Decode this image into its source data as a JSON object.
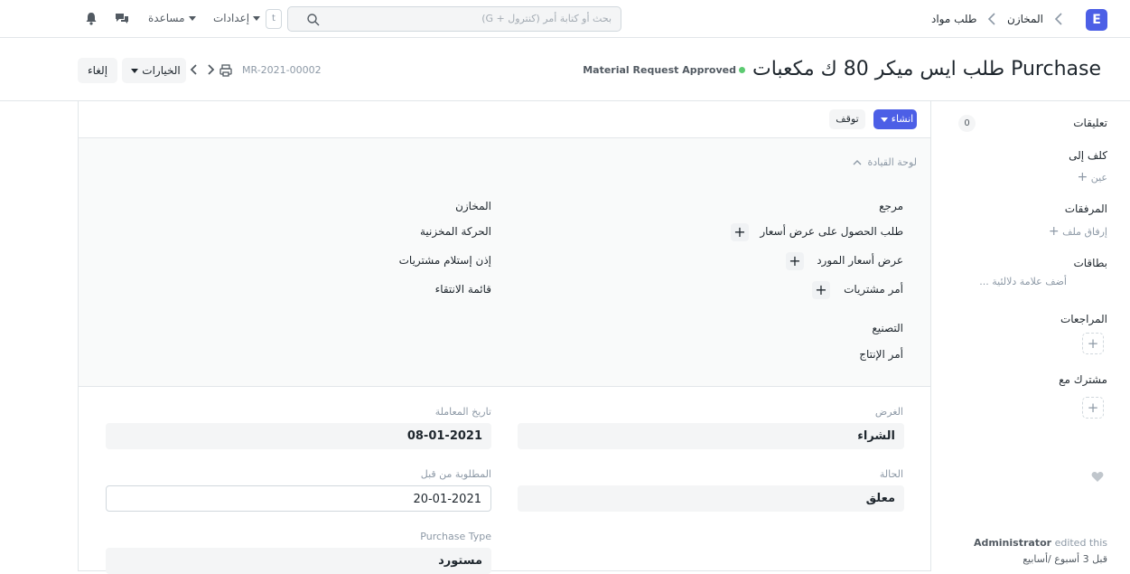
{
  "navbar": {
    "logo": "E",
    "breadcrumbs": [
      "المخازن",
      "طلب مواد"
    ],
    "search_placeholder": "بحث أو كتابة أمر (كنترول + G)",
    "kbd": "t",
    "settings_label": "إعدادات",
    "help_label": "مساعدة"
  },
  "page": {
    "title": "Purchase طلب ايس ميكر 80 ك مكعبات",
    "status": "Material Request Approved",
    "docname": "MR-2021-00002",
    "options_label": "الخيارات",
    "cancel_label": "إلغاء"
  },
  "toolbar": {
    "create_label": "انشاء",
    "stop_label": "توقف"
  },
  "dashboard": {
    "heading": "لوحة القيادة",
    "left_heading": "المخازن",
    "left_items": [
      "الحركة المخزنية",
      "إذن إستلام مشتريات",
      "قائمة الانتقاء"
    ],
    "right_heading": "مرجع",
    "right_items": [
      "طلب الحصول على عرض أسعار",
      "عرض أسعار المورد",
      "أمر مشتريات"
    ],
    "manufacturing_heading": "التصنيع",
    "manufacturing_item": "أمر الإنتاج"
  },
  "form": {
    "purpose_label": "الغرض",
    "purpose_value": "الشراء",
    "transaction_date_label": "تاريخ المعاملة",
    "transaction_date_value": "08-01-2021",
    "status_label": "الحالة",
    "status_value": "معلق",
    "required_by_label": "المطلوبة من قبل",
    "required_by_value": "20-01-2021",
    "purchase_type_label": "Purchase Type",
    "purchase_type_value": "مستورد"
  },
  "sidebar": {
    "comments_label": "تعليقات",
    "comments_count": "0",
    "assign_label": "كلف إلى",
    "assign_add": "عين",
    "attachments_label": "المرفقات",
    "attach_add": "إرفاق ملف",
    "tags_label": "بطاقات",
    "tags_add": "أضف علامة دلالئية ...",
    "reviews_label": "المراجعات",
    "shared_label": "مشترك مع",
    "activity_user": "Administrator",
    "activity_action": "edited this",
    "activity_time": "قبل 3 أسبوع /أسابيع"
  },
  "colors": {
    "primary": "#4c5fe6",
    "indicator_green": "#5cca71"
  }
}
